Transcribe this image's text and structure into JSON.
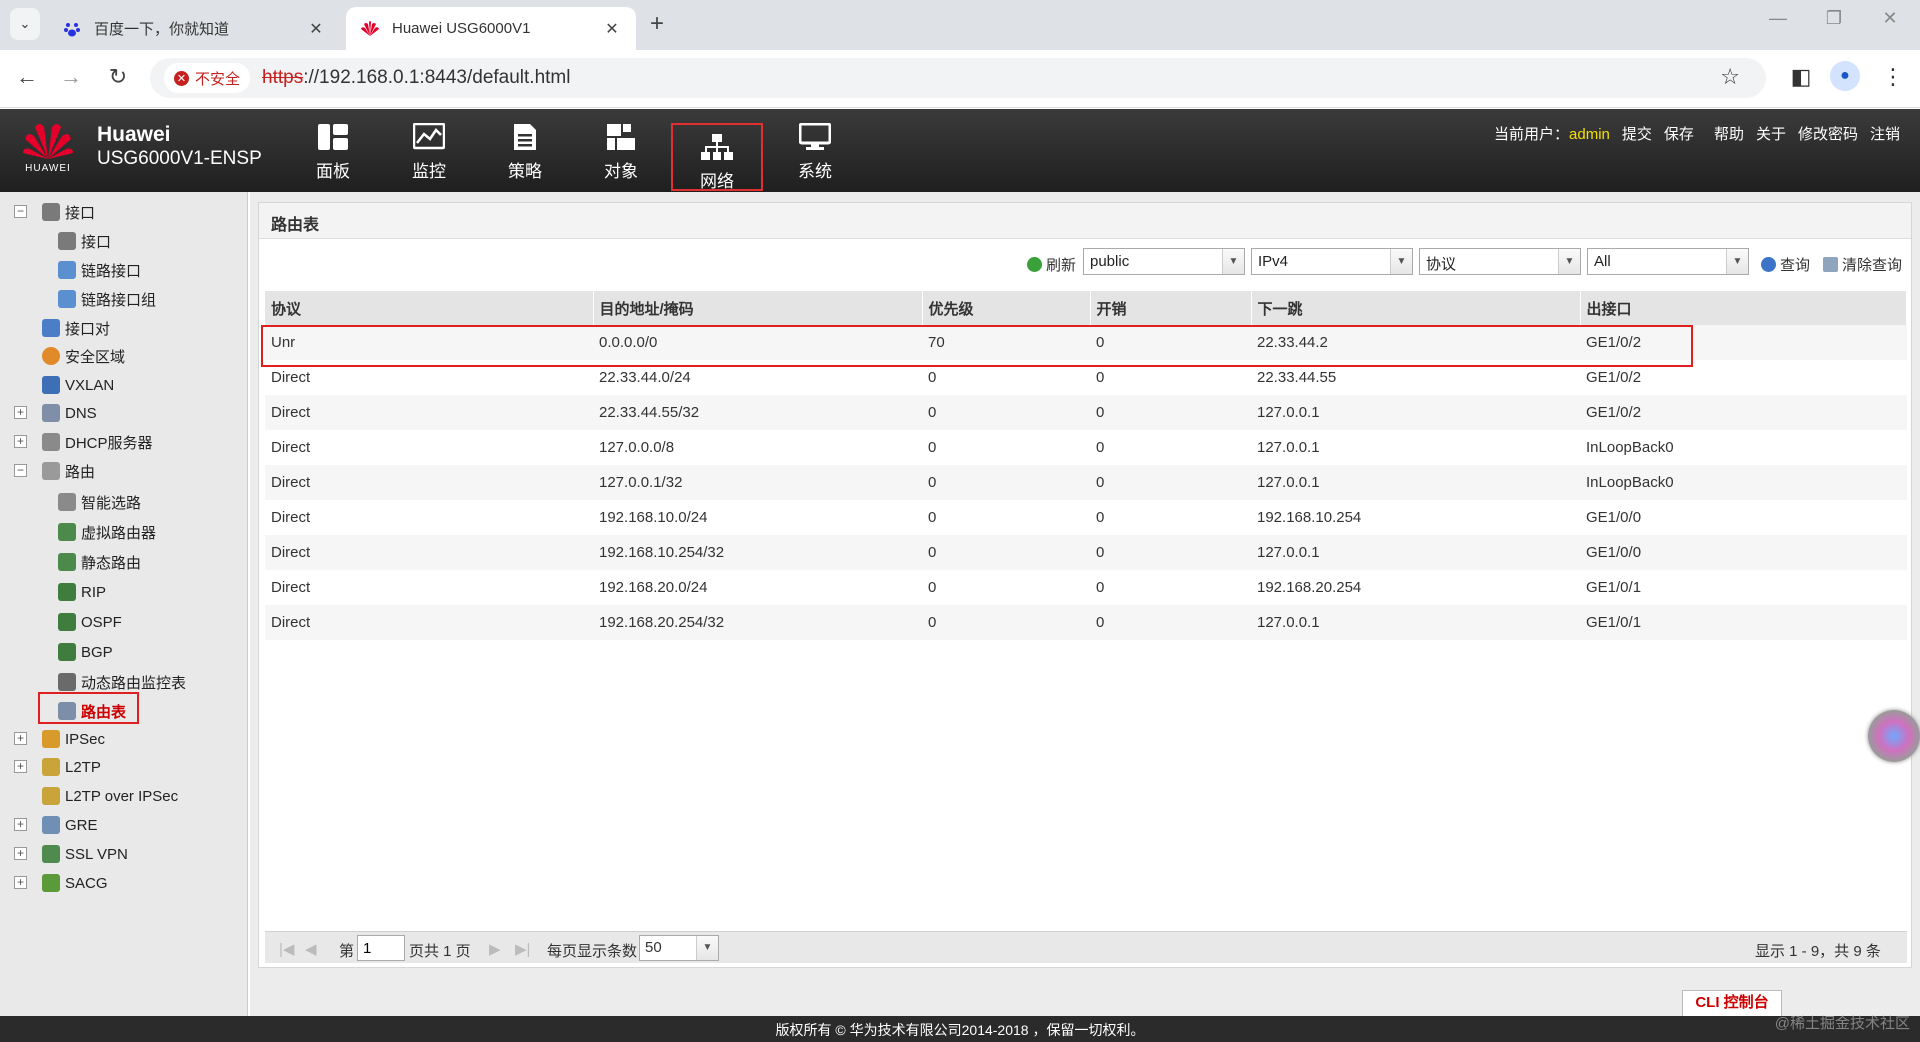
{
  "browser": {
    "tabs": [
      {
        "title": "百度一下，你就知道",
        "active": false,
        "icon": "baidu-icon"
      },
      {
        "title": "Huawei USG6000V1",
        "active": true,
        "icon": "huawei-icon"
      }
    ],
    "security_label": "不安全",
    "url_scheme": "https",
    "url_rest": "://192.168.0.1:8443/default.html"
  },
  "header": {
    "brand_line1": "Huawei",
    "brand_line2": "USG6000V1-ENSP",
    "logo_text": "HUAWEI",
    "nav": [
      {
        "label": "面板",
        "icon": "dashboard-icon"
      },
      {
        "label": "监控",
        "icon": "monitor-icon"
      },
      {
        "label": "策略",
        "icon": "policy-icon"
      },
      {
        "label": "对象",
        "icon": "object-icon"
      },
      {
        "label": "网络",
        "icon": "network-icon",
        "selected": true
      },
      {
        "label": "系统",
        "icon": "system-icon"
      }
    ],
    "current_user_label": "当前用户：",
    "current_user": "admin",
    "actions": [
      "提交",
      "保存",
      "帮助",
      "关于",
      "修改密码",
      "注销"
    ]
  },
  "sidebar": {
    "items": [
      {
        "label": "接口",
        "level": 0,
        "expander": "minus",
        "icon": "interface-icon"
      },
      {
        "label": "接口",
        "level": 1,
        "icon": "interface-icon"
      },
      {
        "label": "链路接口",
        "level": 1,
        "icon": "link-interface-icon"
      },
      {
        "label": "链路接口组",
        "level": 1,
        "icon": "link-interface-group-icon"
      },
      {
        "label": "接口对",
        "level": 0,
        "icon": "interface-pair-icon"
      },
      {
        "label": "安全区域",
        "level": 0,
        "icon": "security-zone-icon"
      },
      {
        "label": "VXLAN",
        "level": 0,
        "icon": "vxlan-icon"
      },
      {
        "label": "DNS",
        "level": 0,
        "expander": "plus",
        "icon": "dns-icon"
      },
      {
        "label": "DHCP服务器",
        "level": 0,
        "expander": "plus",
        "icon": "dhcp-icon"
      },
      {
        "label": "路由",
        "level": 0,
        "expander": "minus",
        "icon": "routing-icon"
      },
      {
        "label": "智能选路",
        "level": 1,
        "icon": "smart-route-icon"
      },
      {
        "label": "虚拟路由器",
        "level": 1,
        "icon": "virtual-router-icon"
      },
      {
        "label": "静态路由",
        "level": 1,
        "icon": "static-route-icon"
      },
      {
        "label": "RIP",
        "level": 1,
        "icon": "rip-icon"
      },
      {
        "label": "OSPF",
        "level": 1,
        "icon": "ospf-icon"
      },
      {
        "label": "BGP",
        "level": 1,
        "icon": "bgp-icon"
      },
      {
        "label": "动态路由监控表",
        "level": 1,
        "icon": "dynamic-route-monitor-icon"
      },
      {
        "label": "路由表",
        "level": 1,
        "icon": "route-table-icon",
        "selected": true
      },
      {
        "label": "IPSec",
        "level": 0,
        "expander": "plus",
        "icon": "ipsec-icon"
      },
      {
        "label": "L2TP",
        "level": 0,
        "expander": "plus",
        "icon": "l2tp-icon"
      },
      {
        "label": "L2TP over IPSec",
        "level": 0,
        "icon": "l2tp-ipsec-icon"
      },
      {
        "label": "GRE",
        "level": 0,
        "expander": "plus",
        "icon": "gre-icon"
      },
      {
        "label": "SSL VPN",
        "level": 0,
        "expander": "plus",
        "icon": "ssl-vpn-icon"
      },
      {
        "label": "SACG",
        "level": 0,
        "expander": "plus",
        "icon": "sacg-icon"
      }
    ]
  },
  "main": {
    "title": "路由表",
    "refresh_label": "刷新",
    "vrf_value": "public",
    "ip_version_value": "IPv4",
    "protocol_value": "协议",
    "scope_value": "All",
    "query_label": "查询",
    "clear_query_label": "清除查询",
    "columns": [
      "协议",
      "目的地址/掩码",
      "优先级",
      "开销",
      "下一跳",
      "出接口"
    ],
    "rows": [
      [
        "Unr",
        "0.0.0.0/0",
        "70",
        "0",
        "22.33.44.2",
        "GE1/0/2"
      ],
      [
        "Direct",
        "22.33.44.0/24",
        "0",
        "0",
        "22.33.44.55",
        "GE1/0/2"
      ],
      [
        "Direct",
        "22.33.44.55/32",
        "0",
        "0",
        "127.0.0.1",
        "GE1/0/2"
      ],
      [
        "Direct",
        "127.0.0.0/8",
        "0",
        "0",
        "127.0.0.1",
        "InLoopBack0"
      ],
      [
        "Direct",
        "127.0.0.1/32",
        "0",
        "0",
        "127.0.0.1",
        "InLoopBack0"
      ],
      [
        "Direct",
        "192.168.10.0/24",
        "0",
        "0",
        "192.168.10.254",
        "GE1/0/0"
      ],
      [
        "Direct",
        "192.168.10.254/32",
        "0",
        "0",
        "127.0.0.1",
        "GE1/0/0"
      ],
      [
        "Direct",
        "192.168.20.0/24",
        "0",
        "0",
        "192.168.20.254",
        "GE1/0/1"
      ],
      [
        "Direct",
        "192.168.20.254/32",
        "0",
        "0",
        "127.0.0.1",
        "GE1/0/1"
      ]
    ],
    "pager": {
      "page_prefix": "第",
      "page_value": "1",
      "page_suffix": "页共 1 页",
      "per_page_label": "每页显示条数",
      "per_page_value": "50",
      "summary": "显示 1 - 9，共 9 条"
    }
  },
  "cli_label": "CLI 控制台",
  "footer": "版权所有 © 华为技术有限公司2014-2018 ，保留一切权利。",
  "watermark": "@稀土掘金技术社区",
  "colors": {
    "highlight_red": "#e02020",
    "user_yellow": "#f5e000",
    "header_dark": "#2b2b2b"
  }
}
